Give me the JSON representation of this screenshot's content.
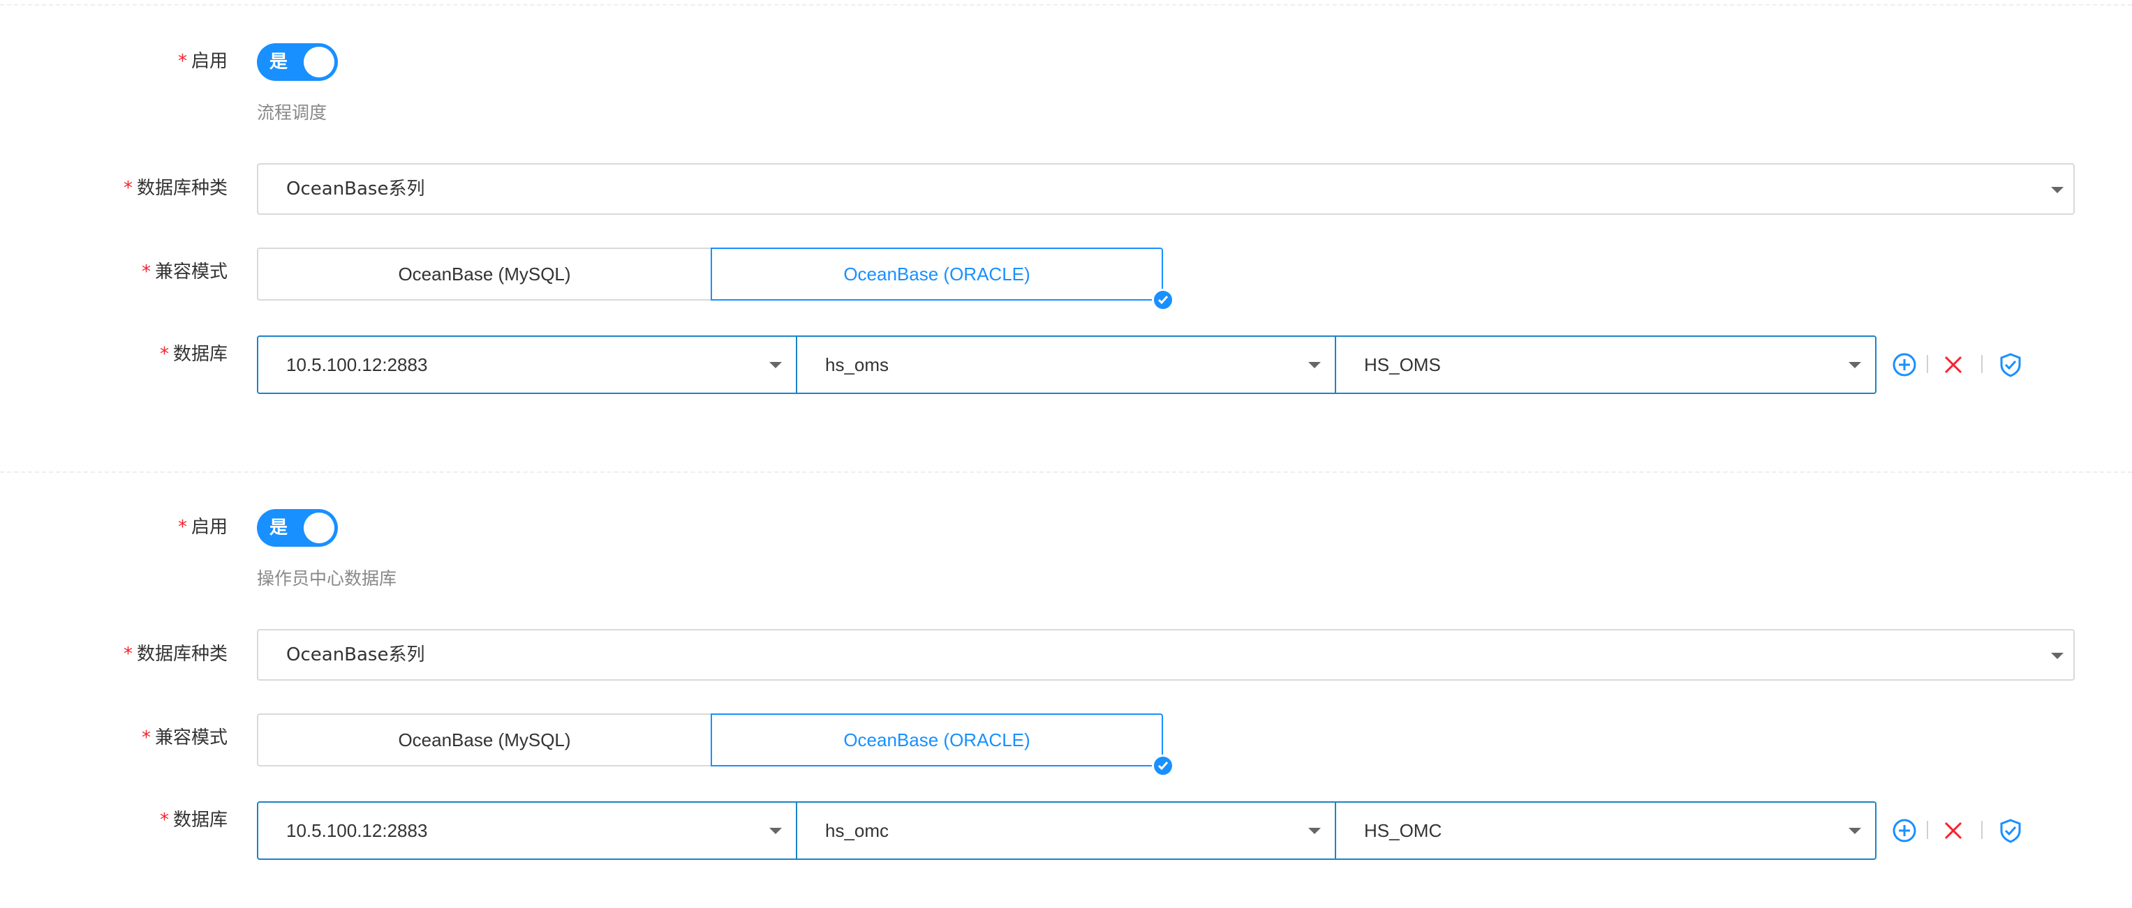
{
  "sections": [
    {
      "enable": {
        "label": "启用",
        "switch_text": "是",
        "on": true
      },
      "help_text": "流程调度",
      "db_type": {
        "label": "数据库种类",
        "value": "OceanBase系列"
      },
      "compat_mode": {
        "label": "兼容模式",
        "options": [
          "OceanBase (MySQL)",
          "OceanBase (ORACLE)"
        ],
        "selected": "OceanBase (ORACLE)"
      },
      "database": {
        "label": "数据库",
        "values": [
          "10.5.100.12:2883",
          "hs_oms",
          "HS_OMS"
        ]
      }
    },
    {
      "enable": {
        "label": "启用",
        "switch_text": "是",
        "on": true
      },
      "help_text": "操作员中心数据库",
      "db_type": {
        "label": "数据库种类",
        "value": "OceanBase系列"
      },
      "compat_mode": {
        "label": "兼容模式",
        "options": [
          "OceanBase (MySQL)",
          "OceanBase (ORACLE)"
        ],
        "selected": "OceanBase (ORACLE)"
      },
      "database": {
        "label": "数据库",
        "values": [
          "10.5.100.12:2883",
          "hs_omc",
          "HS_OMC"
        ]
      }
    }
  ],
  "required_mark": "*",
  "colors": {
    "primary": "#1890ff",
    "danger": "#f5222d",
    "border": "#d9d9d9",
    "db_border": "#1a84c7"
  },
  "icons": {
    "add": "plus-circle-icon",
    "remove": "close-icon",
    "test": "shield-check-icon",
    "dropdown": "caret-down-icon",
    "selected": "check-badge-icon"
  }
}
